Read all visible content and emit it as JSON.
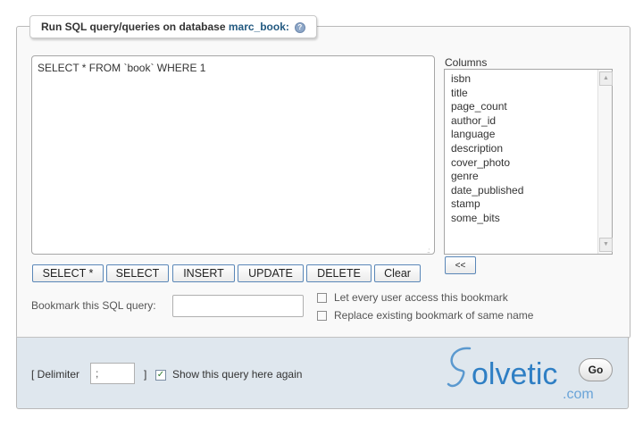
{
  "legend": {
    "prefix": "Run SQL query/queries on database ",
    "db": "marc_book:"
  },
  "query": {
    "text": "SELECT * FROM `book` WHERE 1"
  },
  "columns": {
    "label": "Columns",
    "items": [
      "isbn",
      "title",
      "page_count",
      "author_id",
      "language",
      "description",
      "cover_photo",
      "genre",
      "date_published",
      "stamp",
      "some_bits"
    ],
    "insert_button": "<<"
  },
  "buttons": {
    "select_star": "SELECT *",
    "select": "SELECT",
    "insert": "INSERT",
    "update": "UPDATE",
    "delete": "DELETE",
    "clear": "Clear"
  },
  "bookmark": {
    "label": "Bookmark this SQL query:",
    "value": "",
    "every_user": {
      "label": "Let every user access this bookmark",
      "checked": false
    },
    "replace": {
      "label": "Replace existing bookmark of same name",
      "checked": false
    }
  },
  "footer": {
    "delimiter_open": "[ Delimiter",
    "delimiter_value": ";",
    "delimiter_close": "]",
    "show_query": {
      "label": "Show this query here again",
      "checked": true
    },
    "go": "Go"
  },
  "logo": {
    "text": "olvetic",
    "suffix": ".com"
  },
  "colors": {
    "accent": "#235a81",
    "button_border": "#5a87b8",
    "footer_bg": "#dfe7ee",
    "logo": "#2f7fc4"
  }
}
